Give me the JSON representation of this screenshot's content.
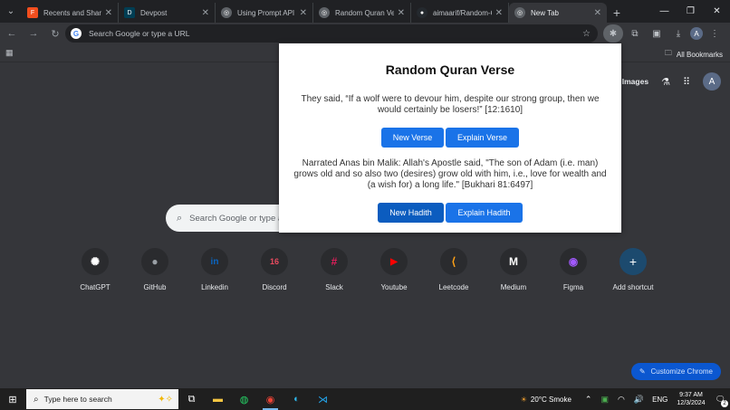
{
  "tabs": [
    {
      "title": "Recents and Sharing",
      "icon": "figma-icon",
      "color": "#f24e1e"
    },
    {
      "title": "Devpost",
      "icon": "devpost-icon",
      "color": "#003e54"
    },
    {
      "title": "Using Prompt API",
      "icon": "chrome-icon",
      "color": "#5f6368"
    },
    {
      "title": "Random Quran Verse",
      "icon": "chrome-icon",
      "color": "#5f6368"
    },
    {
      "title": "aimaarif/Random-Q...",
      "icon": "github-icon",
      "color": "#24292e"
    },
    {
      "title": "New Tab",
      "icon": "chrome-icon",
      "color": "#5f6368",
      "active": true
    }
  ],
  "omnibox": {
    "placeholder": "Search Google or type a URL"
  },
  "bookmarks": {
    "all_label": "All Bookmarks"
  },
  "ntp": {
    "images_label": "Images",
    "avatar_letter": "A",
    "search_placeholder": "Search Google or type a URL",
    "customize_label": "Customize Chrome"
  },
  "shortcuts": [
    {
      "label": "ChatGPT",
      "icon": "chatgpt-icon",
      "glyph": "✺",
      "color": "#ffffff"
    },
    {
      "label": "GitHub",
      "icon": "github-icon",
      "glyph": "●",
      "color": "#9aa0a6"
    },
    {
      "label": "Linkedin",
      "icon": "linkedin-icon",
      "glyph": "in",
      "color": "#0a66c2"
    },
    {
      "label": "Discord",
      "icon": "discord-icon",
      "glyph": "16",
      "color": "#e84a5f"
    },
    {
      "label": "Slack",
      "icon": "slack-icon",
      "glyph": "#",
      "color": "#e01e5a"
    },
    {
      "label": "Youtube",
      "icon": "youtube-icon",
      "glyph": "▶",
      "color": "#ff0000"
    },
    {
      "label": "Leetcode",
      "icon": "leetcode-icon",
      "glyph": "⟨",
      "color": "#ffa116"
    },
    {
      "label": "Medium",
      "icon": "medium-icon",
      "glyph": "M",
      "color": "#ffffff"
    },
    {
      "label": "Figma",
      "icon": "figma-icon",
      "glyph": "◉",
      "color": "#a259ff"
    },
    {
      "label": "Add shortcut",
      "icon": "plus-icon",
      "glyph": "+",
      "color": "#ffffff"
    }
  ],
  "popup": {
    "title": "Random Quran Verse",
    "verse": "They said, “If a wolf were to devour him, despite our strong group, then we would certainly be losers!” [12:1610]",
    "new_verse": "New Verse",
    "explain_verse": "Explain Verse",
    "hadith": "Narrated Anas bin Malik: Allah's Apostle said, \"The son of Adam (i.e. man) grows old and so also two (desires) grow old with him, i.e., love for wealth and (a wish for) a long life.\" [Bukhari 81:6497]",
    "new_hadith": "New Hadith",
    "explain_hadith": "Explain Hadith"
  },
  "taskbar": {
    "search_placeholder": "Type here to search",
    "weather": "20°C  Smoke",
    "language": "ENG",
    "time": "9:37 AM",
    "date": "12/3/2024",
    "notification_count": "2"
  }
}
